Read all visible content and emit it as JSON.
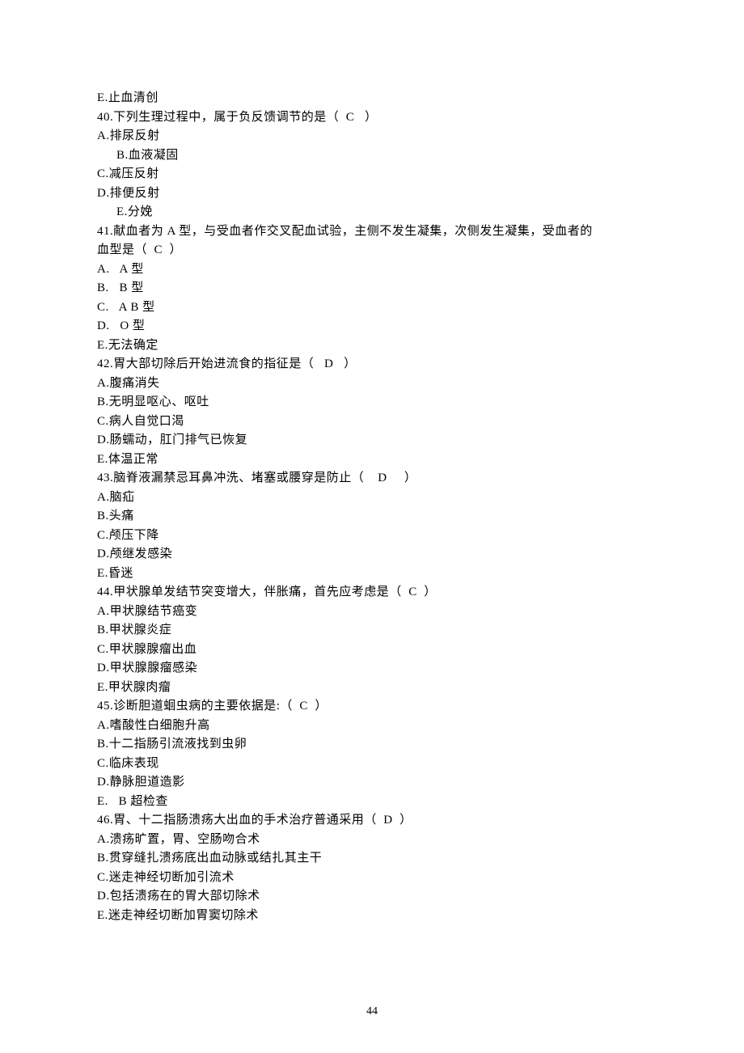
{
  "lines": [
    {
      "cls": "",
      "t": "E.止血清创"
    },
    {
      "cls": "",
      "t": "40.下列生理过程中，属于负反馈调节的是（  C   ）"
    },
    {
      "cls": "",
      "t": "A.排尿反射"
    },
    {
      "cls": "indent",
      "t": "B.血液凝固"
    },
    {
      "cls": "",
      "t": "C.减压反射"
    },
    {
      "cls": "",
      "t": "D.排便反射"
    },
    {
      "cls": "indent",
      "t": "E.分娩"
    },
    {
      "cls": "",
      "t": "41.献血者为 A 型，与受血者作交叉配血试验，主侧不发生凝集，次侧发生凝集，受血者的"
    },
    {
      "cls": "",
      "t": "血型是（  C  ）"
    },
    {
      "cls": "",
      "t": "A.   A 型"
    },
    {
      "cls": "",
      "t": "B.   B 型"
    },
    {
      "cls": "",
      "t": "C.   A B 型"
    },
    {
      "cls": "",
      "t": "D.   O 型"
    },
    {
      "cls": "",
      "t": "E.无法确定"
    },
    {
      "cls": "",
      "t": "42.胃大部切除后开始进流食的指征是（   D   ）"
    },
    {
      "cls": "",
      "t": "A.腹痛消失"
    },
    {
      "cls": "",
      "t": "B.无明显呕心、呕吐"
    },
    {
      "cls": "",
      "t": "C.病人自觉口渴"
    },
    {
      "cls": "",
      "t": "D.肠蠕动，肛门排气已恢复"
    },
    {
      "cls": "",
      "t": "E.体温正常"
    },
    {
      "cls": "",
      "t": "43.脑脊液漏禁忌耳鼻冲洗、堵塞或腰穿是防止（    D     ）"
    },
    {
      "cls": "",
      "t": "A.脑疝"
    },
    {
      "cls": "",
      "t": "B.头痛"
    },
    {
      "cls": "",
      "t": "C.颅压下降"
    },
    {
      "cls": "",
      "t": "D.颅继发感染"
    },
    {
      "cls": "",
      "t": "E.昏迷"
    },
    {
      "cls": "",
      "t": "44.甲状腺单发结节突变增大，伴胀痛，首先应考虑是（  C  ）"
    },
    {
      "cls": "",
      "t": "A.甲状腺结节癌变"
    },
    {
      "cls": "",
      "t": "B.甲状腺炎症"
    },
    {
      "cls": "",
      "t": "C.甲状腺腺瘤出血"
    },
    {
      "cls": "",
      "t": "D.甲状腺腺瘤感染"
    },
    {
      "cls": "",
      "t": "E.甲状腺肉瘤"
    },
    {
      "cls": "",
      "t": "45.诊断胆道蛔虫病的主要依据是:（  C  ）"
    },
    {
      "cls": "",
      "t": "A.嗜酸性白细胞升高"
    },
    {
      "cls": "",
      "t": "B.十二指肠引流液找到虫卵"
    },
    {
      "cls": "",
      "t": "C.临床表现"
    },
    {
      "cls": "",
      "t": "D.静脉胆道造影"
    },
    {
      "cls": "",
      "t": "E.   B 超检查"
    },
    {
      "cls": "",
      "t": "46.胃、十二指肠溃疡大出血的手术治疗普通采用（  D  ）"
    },
    {
      "cls": "",
      "t": "A.溃疡旷置，胃、空肠吻合术"
    },
    {
      "cls": "",
      "t": "B.贯穿缝扎溃疡底出血动脉或结扎其主干"
    },
    {
      "cls": "",
      "t": "C.迷走神经切断加引流术"
    },
    {
      "cls": "",
      "t": "D.包括溃疡在的胃大部切除术"
    },
    {
      "cls": "",
      "t": "E.迷走神经切断加胃窦切除术"
    }
  ],
  "page_number": "44"
}
